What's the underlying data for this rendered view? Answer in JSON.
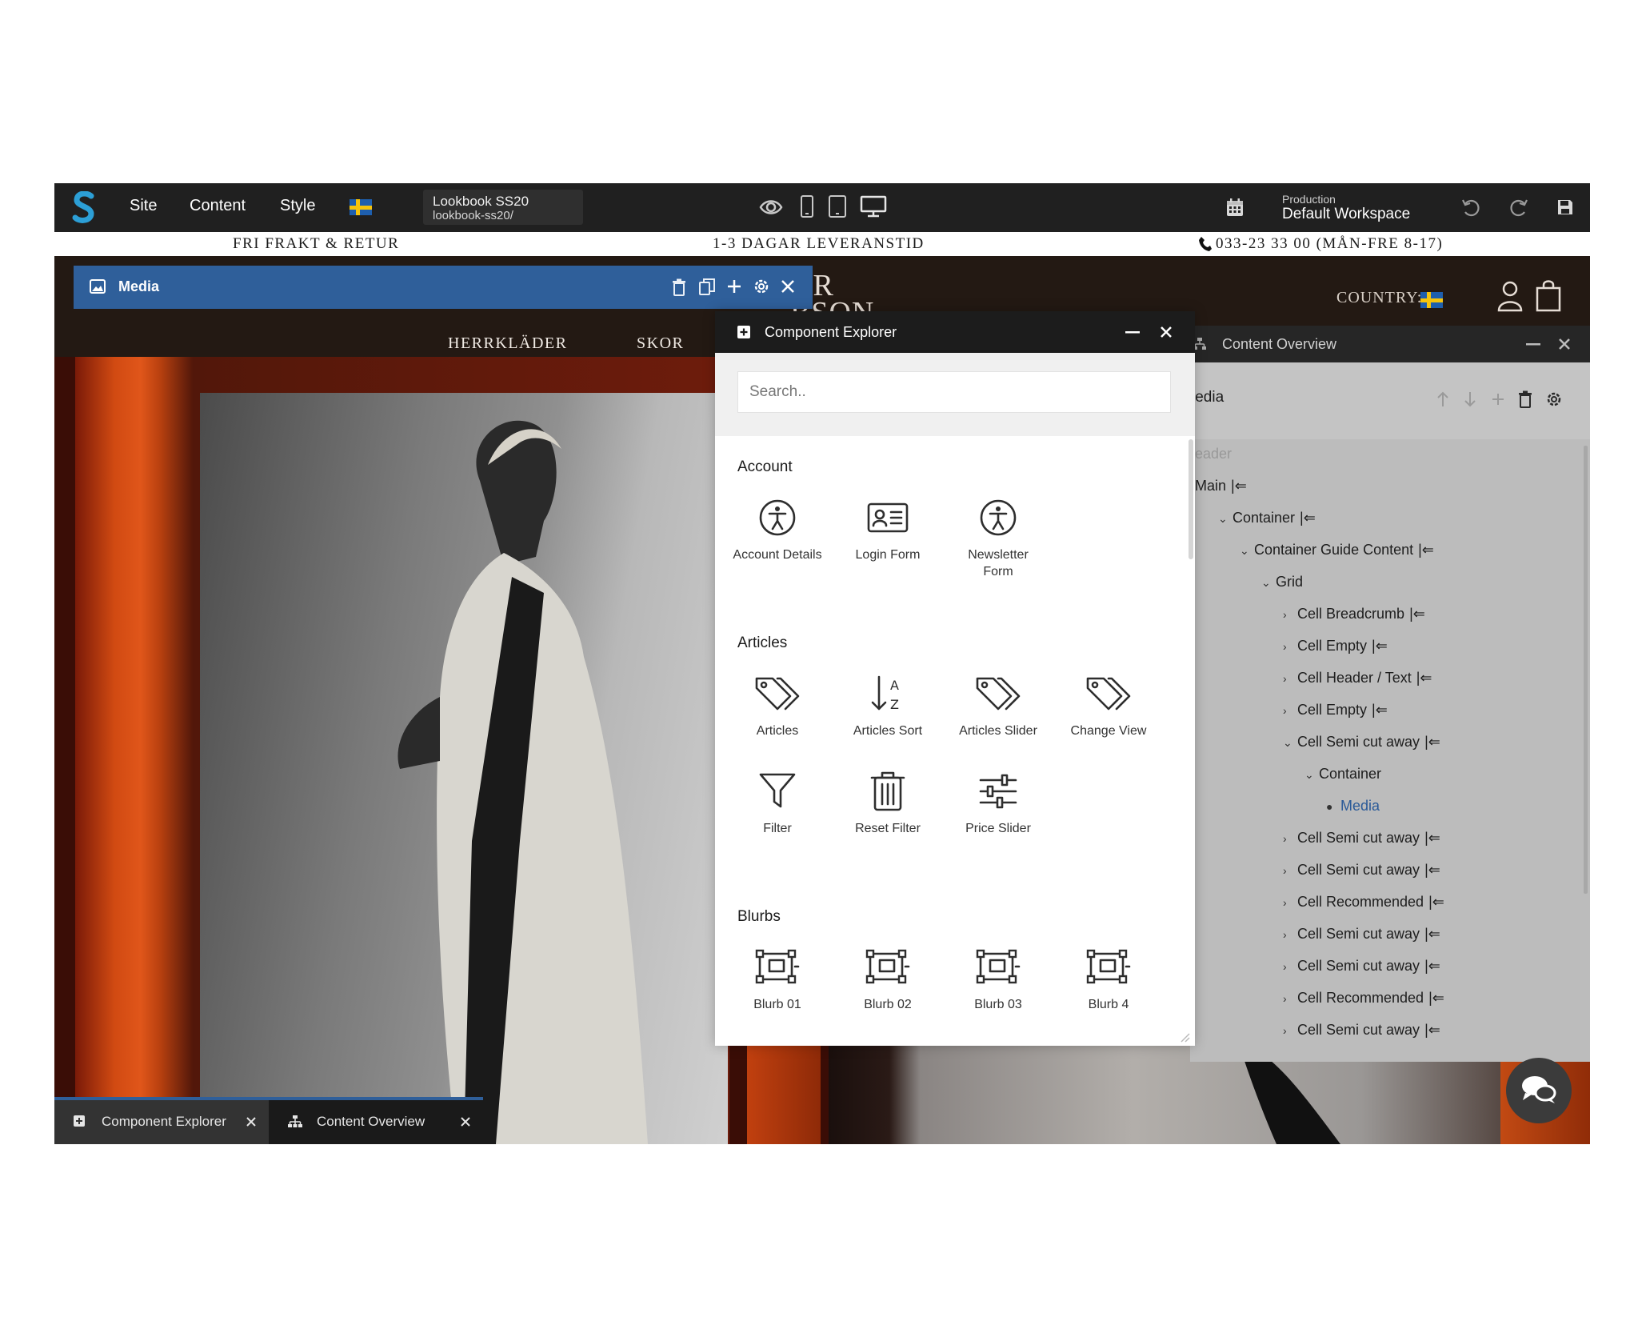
{
  "toolbar": {
    "menu": [
      "Site",
      "Content",
      "Style"
    ],
    "page_title": "Lookbook SS20",
    "page_path": "lookbook-ss20/",
    "workspace_env": "Production",
    "workspace_name": "Default Workspace"
  },
  "site": {
    "strip": [
      "FRI FRAKT & RETUR",
      "1-3 DAGAR LEVERANSTID",
      "033-23 33 00 (MÅN-FRE 8-17)"
    ],
    "logo_text": "AR\nBSON",
    "country_label": "COUNTRY:",
    "nav": [
      "HERRKLÄDER",
      "SKOR"
    ]
  },
  "media_panel": {
    "title": "Media"
  },
  "component_explorer": {
    "title": "Component Explorer",
    "search_placeholder": "Search..",
    "sections": [
      {
        "name": "Account",
        "items": [
          {
            "label": "Account Details",
            "icon": "accessibility-icon"
          },
          {
            "label": "Login Form",
            "icon": "id-card-icon"
          },
          {
            "label": "Newsletter\nForm",
            "icon": "accessibility-icon"
          }
        ]
      },
      {
        "name": "Articles",
        "items": [
          {
            "label": "Articles",
            "icon": "tags-icon"
          },
          {
            "label": "Articles Sort",
            "icon": "sort-az-icon"
          },
          {
            "label": "Articles Slider",
            "icon": "tags-icon"
          },
          {
            "label": "Change View",
            "icon": "tags-icon"
          },
          {
            "label": "Filter",
            "icon": "filter-icon"
          },
          {
            "label": "Reset Filter",
            "icon": "trash-icon"
          },
          {
            "label": "Price Slider",
            "icon": "sliders-icon"
          }
        ]
      },
      {
        "name": "Blurbs",
        "items": [
          {
            "label": "Blurb 01",
            "icon": "blurb-icon"
          },
          {
            "label": "Blurb 02",
            "icon": "blurb-icon"
          },
          {
            "label": "Blurb 03",
            "icon": "blurb-icon"
          },
          {
            "label": "Blurb 4",
            "icon": "blurb-icon"
          }
        ]
      }
    ]
  },
  "content_overview": {
    "title": "Content Overview",
    "selected_title": "ledia",
    "tree": [
      {
        "label": "eader",
        "depth": 0,
        "dim": true
      },
      {
        "label": "Main",
        "depth": 0
      },
      {
        "label": "Container",
        "depth": 1,
        "expanded": true
      },
      {
        "label": "Container Guide Content",
        "depth": 2,
        "expanded": true
      },
      {
        "label": "Grid",
        "depth": 3,
        "expanded": true
      },
      {
        "label": "Cell Breadcrumb",
        "depth": 4
      },
      {
        "label": "Cell Empty",
        "depth": 4
      },
      {
        "label": "Cell Header / Text",
        "depth": 4
      },
      {
        "label": "Cell Empty",
        "depth": 4
      },
      {
        "label": "Cell Semi cut away",
        "depth": 4,
        "expanded": true
      },
      {
        "label": "Container",
        "depth": 5,
        "expanded": true
      },
      {
        "label": "Media",
        "depth": 6,
        "selected": true
      },
      {
        "label": "Cell Semi cut away",
        "depth": 4
      },
      {
        "label": "Cell Semi cut away",
        "depth": 4
      },
      {
        "label": "Cell Recommended",
        "depth": 4
      },
      {
        "label": "Cell Semi cut away",
        "depth": 4
      },
      {
        "label": "Cell Semi cut away",
        "depth": 4
      },
      {
        "label": "Cell Recommended",
        "depth": 4
      },
      {
        "label": "Cell Semi cut away",
        "depth": 4
      }
    ]
  },
  "bottom_tabs": [
    {
      "label": "Component Explorer",
      "icon": "plus-square-icon"
    },
    {
      "label": "Content Overview",
      "icon": "sitemap-icon"
    }
  ],
  "colors": {
    "accent_blue": "#2f5f9a",
    "toolbar_bg": "#202020",
    "selected_text": "#2a5a98"
  }
}
